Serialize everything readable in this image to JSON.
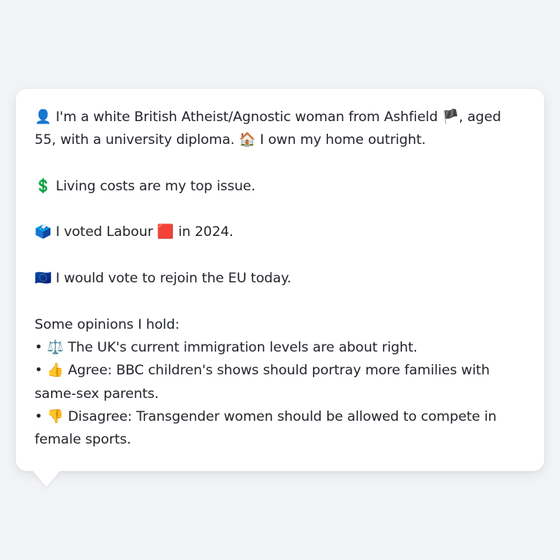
{
  "message": {
    "intro": {
      "icon": "👤",
      "text_a": " I'm a white British Atheist/Agnostic woman from Ashfield ",
      "flag": "🏴",
      "text_b": ", aged 55, with a university diploma. ",
      "home_icon": "🏠",
      "text_c": " I own my home outright."
    },
    "issue": {
      "icon": "💲",
      "text": " Living costs are my top issue."
    },
    "vote": {
      "icon": "🗳️",
      "text_a": " I voted Labour ",
      "party_icon": "🟥",
      "text_b": " in 2024."
    },
    "eu": {
      "icon": "🇪🇺",
      "text": " I would vote to rejoin the EU today."
    },
    "opinions_heading": "Some opinions I hold:",
    "opinions": [
      {
        "bullet": "• ",
        "icon": "⚖️",
        "text": " The UK's current immigration levels are about right."
      },
      {
        "bullet": "• ",
        "icon": "👍",
        "text": " Agree: BBC children's shows should portray more families with same-sex parents."
      },
      {
        "bullet": "• ",
        "icon": "👎",
        "text": " Disagree: Transgender women should be allowed to compete in female sports."
      }
    ]
  },
  "colors": {
    "page_background": "#f1f3f6",
    "bubble_background": "#ffffff",
    "text": "#22252b"
  }
}
